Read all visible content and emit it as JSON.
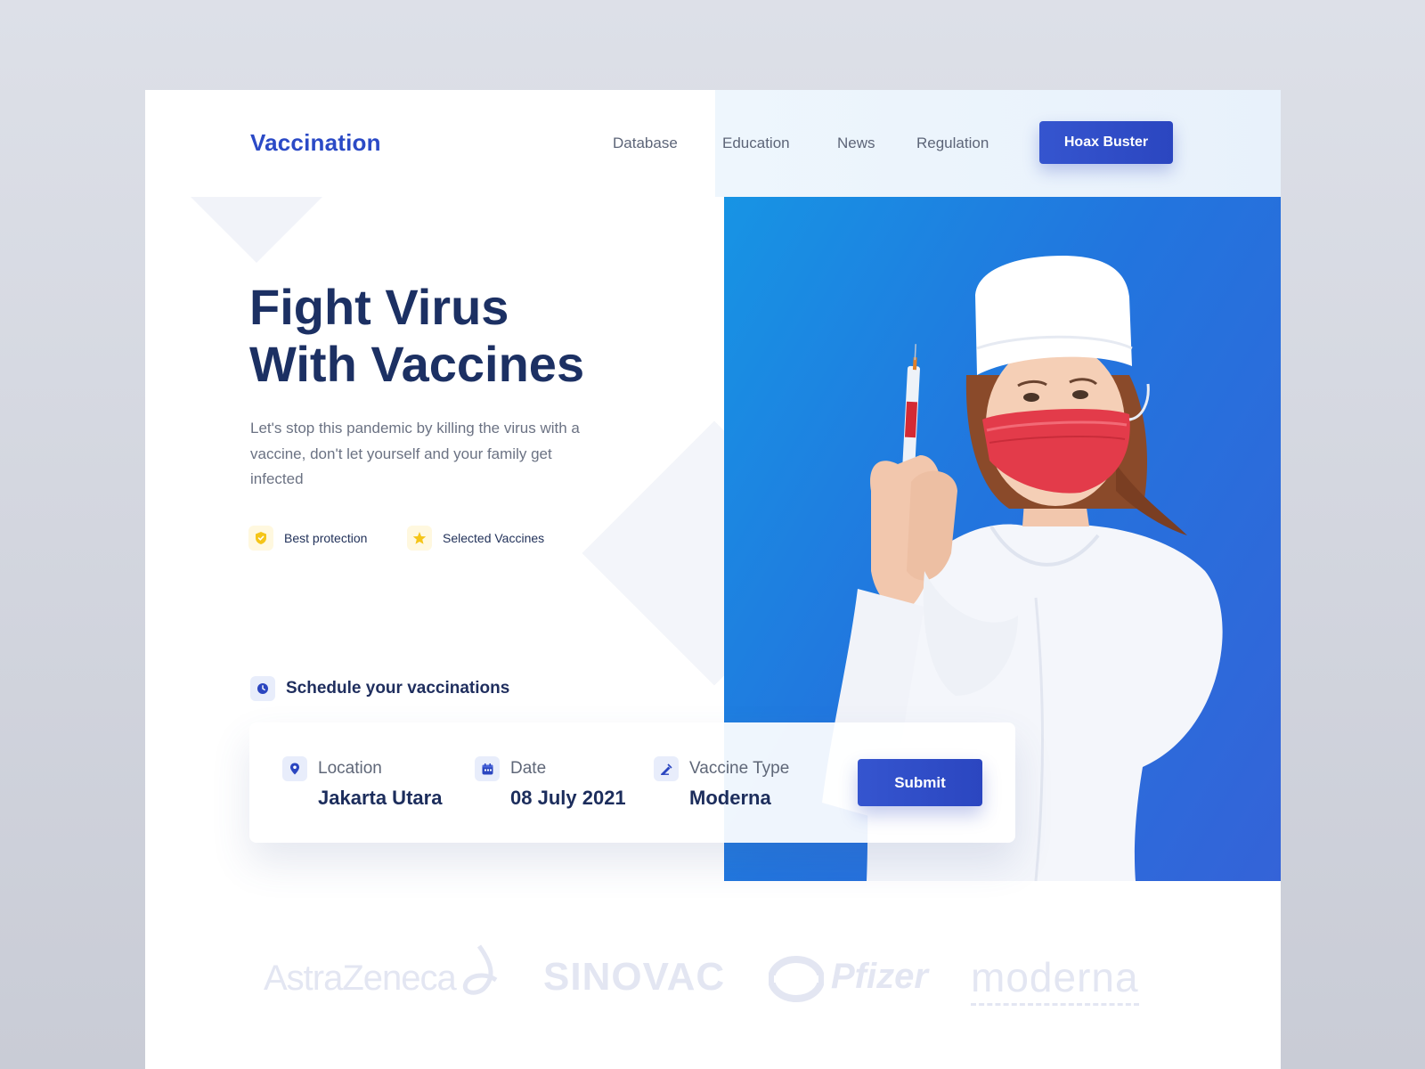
{
  "header": {
    "logo": "Vaccination",
    "nav": [
      "Database",
      "Education",
      "News",
      "Regulation"
    ],
    "cta": "Hoax Buster"
  },
  "hero": {
    "title_line1": "Fight Virus",
    "title_line2": "With Vaccines",
    "description": "Let's stop this pandemic by killing the virus with a vaccine, don't let yourself and your family get infected",
    "features": [
      {
        "label": "Best protection",
        "icon": "shield-icon"
      },
      {
        "label": "Selected Vaccines",
        "icon": "star-icon"
      }
    ],
    "image": "nurse holding syringe"
  },
  "schedule": {
    "heading": "Schedule your vaccinations",
    "heading_icon": "clock-icon",
    "fields": [
      {
        "label": "Location",
        "value": "Jakarta Utara",
        "icon": "location-pin-icon"
      },
      {
        "label": "Date",
        "value": "08 July 2021",
        "icon": "calendar-icon"
      },
      {
        "label": "Vaccine Type",
        "value": "Moderna",
        "icon": "syringe-icon"
      }
    ],
    "submit": "Submit"
  },
  "partners": [
    "AstraZeneca",
    "SINOVAC",
    "Pfizer",
    "moderna"
  ],
  "colors": {
    "brand": "#2b4ac6",
    "heading": "#1c3063",
    "accent_yellow": "#f5c518",
    "hero_gradient_start": "#1794e4",
    "hero_gradient_end": "#3463d8"
  }
}
